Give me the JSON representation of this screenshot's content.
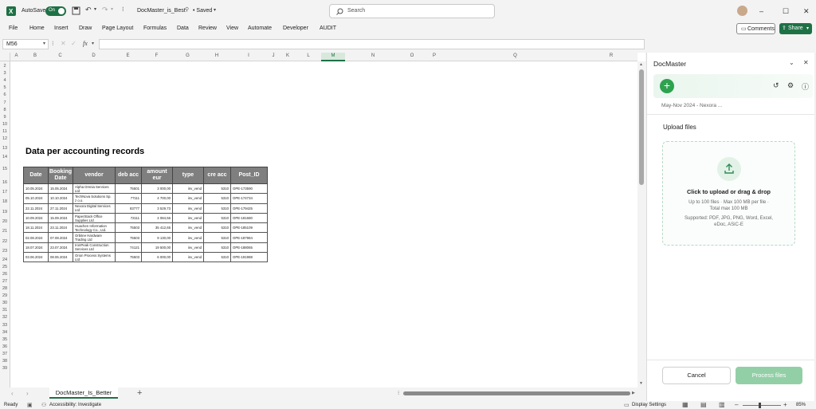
{
  "titlebar": {
    "autosave_label": "AutoSave",
    "toggle_state": "On",
    "filename": "DocMaster_is_Best",
    "saved_state": "• Saved",
    "search_placeholder": "Search"
  },
  "ribbon": {
    "tabs": [
      "File",
      "Home",
      "Insert",
      "Draw",
      "Page Layout",
      "Formulas",
      "Data",
      "Review",
      "View",
      "Automate",
      "Developer",
      "AUDIT"
    ],
    "comments_label": "Comments",
    "share_label": "Share"
  },
  "formula_bar": {
    "name_box": "M56",
    "fx_label": "fx",
    "value": ""
  },
  "columns": [
    "A",
    "B",
    "C",
    "D",
    "E",
    "F",
    "G",
    "H",
    "I",
    "J",
    "K",
    "L",
    "M",
    "N",
    "O",
    "P",
    "Q",
    "R"
  ],
  "rows": [
    "2",
    "3",
    "4",
    "5",
    "6",
    "7",
    "8",
    "9",
    "10",
    "11",
    "12",
    "13",
    "14",
    "15",
    "16",
    "17",
    "18",
    "19",
    "20",
    "21",
    "22",
    "23",
    "24",
    "25",
    "26",
    "27",
    "28",
    "29",
    "30",
    "31",
    "32",
    "33",
    "34",
    "35",
    "36",
    "37",
    "38",
    "39"
  ],
  "sheet": {
    "title": "Data per accounting records",
    "headers": [
      "Date",
      "Booking Date",
      "vendor",
      "deb acc",
      "amount eur",
      "type",
      "cre acc",
      "Post_ID"
    ],
    "records": [
      [
        "10.05.2024",
        "15.05.2024",
        "Alpha Omnia Services Ltd",
        "75501",
        "3 000,00",
        "inv_vend",
        "5310",
        "OPE-173590"
      ],
      [
        "05.10.2024",
        "10.10.2024",
        "TechNova Solutions Sp. z o.o.",
        "77111",
        "4 700,00",
        "inv_vend",
        "5310",
        "OPE-174734"
      ],
      [
        "22.11.2024",
        "27.11.2024",
        "Nexora Digital Services Ltd",
        "83777",
        "3 529,73",
        "inv_vend",
        "5310",
        "OPE-179425"
      ],
      [
        "10.09.2024",
        "15.09.2024",
        "PaperStack Office Supplies Ltd",
        "72111",
        "4 084,56",
        "inv_vend",
        "5310",
        "OPE-181680"
      ],
      [
        "18.11.2024",
        "23.11.2024",
        "Huachen Information Technology Co., Ltd.",
        "75503",
        "35 412,65",
        "inv_vend",
        "5310",
        "OPE-185109"
      ],
      [
        "02.08.2024",
        "07.08.2024",
        "Orbitee Hardware Trading Ltd",
        "75503",
        "9 130,00",
        "inv_vend",
        "5310",
        "OPE-187984"
      ],
      [
        "18.07.2024",
        "23.07.2024",
        "IronPeak Construction Services Ltd",
        "74121",
        "19 500,00",
        "inv_vend",
        "5310",
        "OPE-188065"
      ],
      [
        "03.06.2024",
        "08.06.2024",
        "Orion Process Systems Ltd",
        "75503",
        "6 000,00",
        "inv_vend",
        "5310",
        "OPE-191988"
      ]
    ],
    "active_tab": "DocMaster_Is_Better"
  },
  "statusbar": {
    "ready": "Ready",
    "accessibility": "Accessibility: Investigate",
    "display_settings": "Display Settings",
    "zoom": "85%"
  },
  "panel": {
    "title": "DocMaster",
    "period": "May-Nov 2024 - Nexora ...",
    "upload_title": "Upload files",
    "dropzone_main": "Click to upload or drag & drop",
    "dropzone_limits_1": "Up to 100 files · Max 100 MB per file ·",
    "dropzone_limits_2": "Total max 100 MB",
    "dropzone_types_1": "Supported: PDF, JPG, PNG, Word, Excel,",
    "dropzone_types_2": "eDoc, ASiC-E",
    "cancel_label": "Cancel",
    "process_label": "Process files"
  },
  "colors": {
    "excel_green": "#1e7145",
    "panel_green": "#2ea24f",
    "header_gray": "#7f7f7f"
  }
}
